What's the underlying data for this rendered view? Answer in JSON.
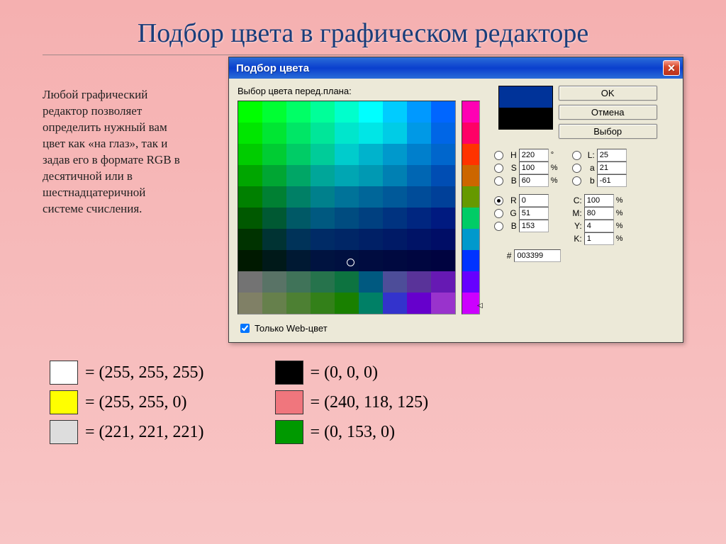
{
  "title": "Подбор цвета в графическом редакторе",
  "sidetext": "Любой графический редактор позволяет определить нужный вам цвет как «на глаз», так и задав его в формате RGB в десятичной или в шестнадцатеричной системе счисления.",
  "dialog": {
    "title": "Подбор цвета",
    "label": "Выбор цвета перед.плана:",
    "web_only": "Только Web-цвет",
    "buttons": {
      "ok": "OK",
      "cancel": "Отмена",
      "select": "Выбор"
    },
    "fields": {
      "H": "220",
      "H_unit": "°",
      "L": "25",
      "S": "100",
      "S_unit": "%",
      "a": "21",
      "B": "60",
      "B_unit": "%",
      "b": "-61",
      "R": "0",
      "C": "100",
      "G": "51",
      "M": "80",
      "Bv": "153",
      "Y": "4",
      "K": "1",
      "hex": "003399"
    }
  },
  "grid_colors": [
    [
      "#00ff00",
      "#00ff33",
      "#00ff66",
      "#00ff99",
      "#00ffcc",
      "#00ffff",
      "#00ccff",
      "#0099ff",
      "#0066ff"
    ],
    [
      "#00e600",
      "#00e633",
      "#00e666",
      "#00e699",
      "#00e6cc",
      "#00e6e6",
      "#00cce6",
      "#0099e6",
      "#0066e6"
    ],
    [
      "#00cc00",
      "#00cc33",
      "#00cc66",
      "#00cc99",
      "#00cccc",
      "#00b3cc",
      "#0099cc",
      "#007fcc",
      "#0066cc"
    ],
    [
      "#00a600",
      "#00a633",
      "#00a666",
      "#00a699",
      "#00a6b3",
      "#0099b3",
      "#0080b3",
      "#0066b3",
      "#004db3"
    ],
    [
      "#008000",
      "#008033",
      "#008066",
      "#00808c",
      "#007399",
      "#006699",
      "#005999",
      "#004c99",
      "#004099"
    ],
    [
      "#005900",
      "#005933",
      "#005966",
      "#005980",
      "#004c80",
      "#004080",
      "#003380",
      "#002680",
      "#001a80"
    ],
    [
      "#003300",
      "#003333",
      "#003359",
      "#002b66",
      "#002666",
      "#002066",
      "#001a66",
      "#001366",
      "#000d66"
    ],
    [
      "#001900",
      "#001919",
      "#001933",
      "#001340",
      "#001040",
      "#000c40",
      "#000940",
      "#000640",
      "#000340"
    ],
    [
      "#737373",
      "#597366",
      "#407359",
      "#26734c",
      "#0d7340",
      "#005980",
      "#4d4d99",
      "#593399",
      "#6619b3"
    ],
    [
      "#808066",
      "#66804c",
      "#4d8033",
      "#338019",
      "#198000",
      "#008066",
      "#3333cc",
      "#6600cc",
      "#9933cc"
    ]
  ],
  "hue_colors": [
    "#ff00b3",
    "#ff0066",
    "#ff3300",
    "#cc6600",
    "#669900",
    "#00cc66",
    "#0099cc",
    "#0033ff",
    "#6600ff",
    "#cc00ff"
  ],
  "swatches_left": [
    {
      "hex": "#ffffff",
      "text": "= (255, 255, 255)"
    },
    {
      "hex": "#ffff00",
      "text": "= (255, 255, 0)"
    },
    {
      "hex": "#dddddd",
      "text": "= (221, 221, 221)"
    }
  ],
  "swatches_right": [
    {
      "hex": "#000000",
      "text": "= (0, 0, 0)"
    },
    {
      "hex": "#f0767d",
      "text": "= (240, 118, 125)"
    },
    {
      "hex": "#009900",
      "text": "= (0, 153, 0)"
    }
  ]
}
